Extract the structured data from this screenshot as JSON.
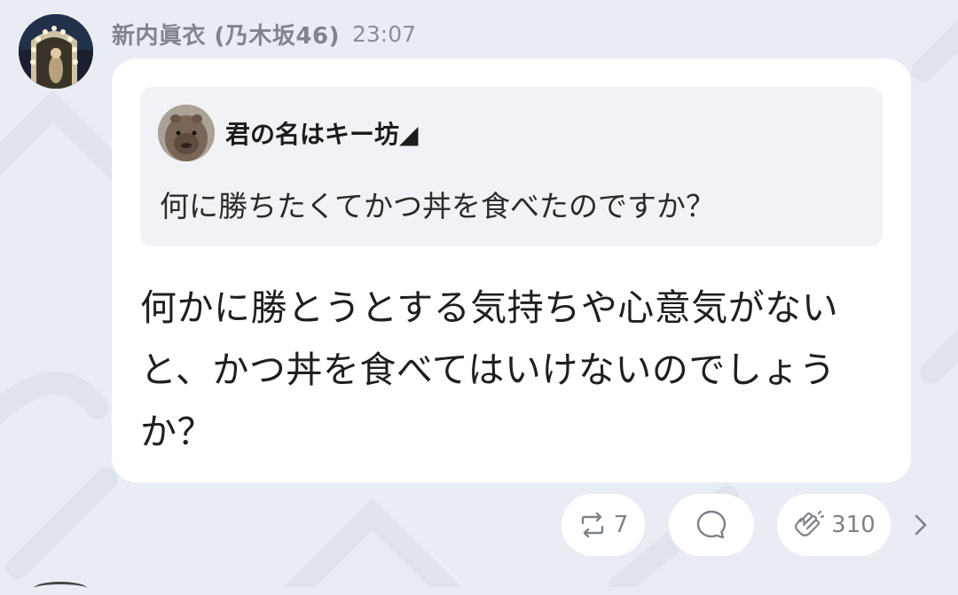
{
  "post": {
    "sender_name": "新内眞衣 (乃木坂46)",
    "timestamp": "23:07",
    "quote": {
      "author": "君の名はキー坊◢",
      "text": "何に勝ちたくてかつ丼を食べたのですか？"
    },
    "message": "何かに勝とうとする気持ちや心意気がないと、かつ丼を食べてはいけないのでしょうか？"
  },
  "actions": {
    "repost_count": "7",
    "clap_count": "310"
  },
  "icons": {
    "repost": "repost-icon",
    "reply": "reply-bubble-icon",
    "clap": "clap-hands-icon",
    "next": "chevron-right-icon"
  },
  "colors": {
    "background": "#e9edf3",
    "bubble": "#ffffff",
    "quote_bg": "#f1f2f5",
    "muted_text": "#80848c"
  }
}
